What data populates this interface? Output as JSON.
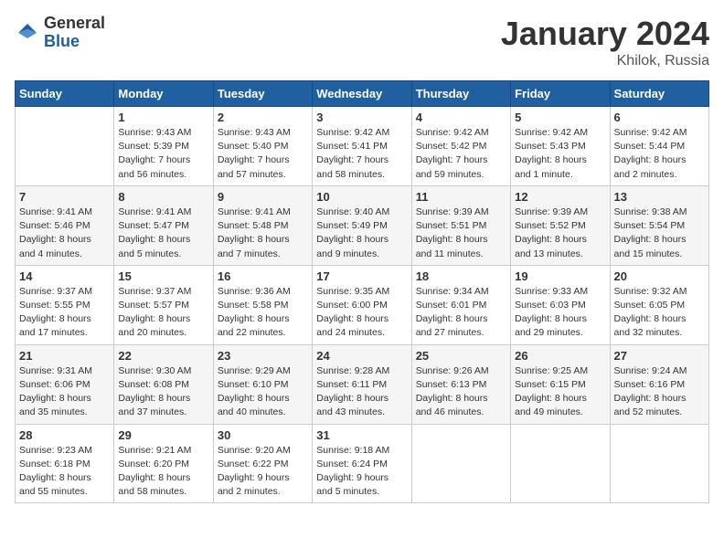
{
  "header": {
    "logo_general": "General",
    "logo_blue": "Blue",
    "month_title": "January 2024",
    "location": "Khilok, Russia"
  },
  "weekdays": [
    "Sunday",
    "Monday",
    "Tuesday",
    "Wednesday",
    "Thursday",
    "Friday",
    "Saturday"
  ],
  "weeks": [
    [
      {
        "day": "",
        "info": ""
      },
      {
        "day": "1",
        "info": "Sunrise: 9:43 AM\nSunset: 5:39 PM\nDaylight: 7 hours\nand 56 minutes."
      },
      {
        "day": "2",
        "info": "Sunrise: 9:43 AM\nSunset: 5:40 PM\nDaylight: 7 hours\nand 57 minutes."
      },
      {
        "day": "3",
        "info": "Sunrise: 9:42 AM\nSunset: 5:41 PM\nDaylight: 7 hours\nand 58 minutes."
      },
      {
        "day": "4",
        "info": "Sunrise: 9:42 AM\nSunset: 5:42 PM\nDaylight: 7 hours\nand 59 minutes."
      },
      {
        "day": "5",
        "info": "Sunrise: 9:42 AM\nSunset: 5:43 PM\nDaylight: 8 hours\nand 1 minute."
      },
      {
        "day": "6",
        "info": "Sunrise: 9:42 AM\nSunset: 5:44 PM\nDaylight: 8 hours\nand 2 minutes."
      }
    ],
    [
      {
        "day": "7",
        "info": "Sunrise: 9:41 AM\nSunset: 5:46 PM\nDaylight: 8 hours\nand 4 minutes."
      },
      {
        "day": "8",
        "info": "Sunrise: 9:41 AM\nSunset: 5:47 PM\nDaylight: 8 hours\nand 5 minutes."
      },
      {
        "day": "9",
        "info": "Sunrise: 9:41 AM\nSunset: 5:48 PM\nDaylight: 8 hours\nand 7 minutes."
      },
      {
        "day": "10",
        "info": "Sunrise: 9:40 AM\nSunset: 5:49 PM\nDaylight: 8 hours\nand 9 minutes."
      },
      {
        "day": "11",
        "info": "Sunrise: 9:39 AM\nSunset: 5:51 PM\nDaylight: 8 hours\nand 11 minutes."
      },
      {
        "day": "12",
        "info": "Sunrise: 9:39 AM\nSunset: 5:52 PM\nDaylight: 8 hours\nand 13 minutes."
      },
      {
        "day": "13",
        "info": "Sunrise: 9:38 AM\nSunset: 5:54 PM\nDaylight: 8 hours\nand 15 minutes."
      }
    ],
    [
      {
        "day": "14",
        "info": "Sunrise: 9:37 AM\nSunset: 5:55 PM\nDaylight: 8 hours\nand 17 minutes."
      },
      {
        "day": "15",
        "info": "Sunrise: 9:37 AM\nSunset: 5:57 PM\nDaylight: 8 hours\nand 20 minutes."
      },
      {
        "day": "16",
        "info": "Sunrise: 9:36 AM\nSunset: 5:58 PM\nDaylight: 8 hours\nand 22 minutes."
      },
      {
        "day": "17",
        "info": "Sunrise: 9:35 AM\nSunset: 6:00 PM\nDaylight: 8 hours\nand 24 minutes."
      },
      {
        "day": "18",
        "info": "Sunrise: 9:34 AM\nSunset: 6:01 PM\nDaylight: 8 hours\nand 27 minutes."
      },
      {
        "day": "19",
        "info": "Sunrise: 9:33 AM\nSunset: 6:03 PM\nDaylight: 8 hours\nand 29 minutes."
      },
      {
        "day": "20",
        "info": "Sunrise: 9:32 AM\nSunset: 6:05 PM\nDaylight: 8 hours\nand 32 minutes."
      }
    ],
    [
      {
        "day": "21",
        "info": "Sunrise: 9:31 AM\nSunset: 6:06 PM\nDaylight: 8 hours\nand 35 minutes."
      },
      {
        "day": "22",
        "info": "Sunrise: 9:30 AM\nSunset: 6:08 PM\nDaylight: 8 hours\nand 37 minutes."
      },
      {
        "day": "23",
        "info": "Sunrise: 9:29 AM\nSunset: 6:10 PM\nDaylight: 8 hours\nand 40 minutes."
      },
      {
        "day": "24",
        "info": "Sunrise: 9:28 AM\nSunset: 6:11 PM\nDaylight: 8 hours\nand 43 minutes."
      },
      {
        "day": "25",
        "info": "Sunrise: 9:26 AM\nSunset: 6:13 PM\nDaylight: 8 hours\nand 46 minutes."
      },
      {
        "day": "26",
        "info": "Sunrise: 9:25 AM\nSunset: 6:15 PM\nDaylight: 8 hours\nand 49 minutes."
      },
      {
        "day": "27",
        "info": "Sunrise: 9:24 AM\nSunset: 6:16 PM\nDaylight: 8 hours\nand 52 minutes."
      }
    ],
    [
      {
        "day": "28",
        "info": "Sunrise: 9:23 AM\nSunset: 6:18 PM\nDaylight: 8 hours\nand 55 minutes."
      },
      {
        "day": "29",
        "info": "Sunrise: 9:21 AM\nSunset: 6:20 PM\nDaylight: 8 hours\nand 58 minutes."
      },
      {
        "day": "30",
        "info": "Sunrise: 9:20 AM\nSunset: 6:22 PM\nDaylight: 9 hours\nand 2 minutes."
      },
      {
        "day": "31",
        "info": "Sunrise: 9:18 AM\nSunset: 6:24 PM\nDaylight: 9 hours\nand 5 minutes."
      },
      {
        "day": "",
        "info": ""
      },
      {
        "day": "",
        "info": ""
      },
      {
        "day": "",
        "info": ""
      }
    ]
  ]
}
